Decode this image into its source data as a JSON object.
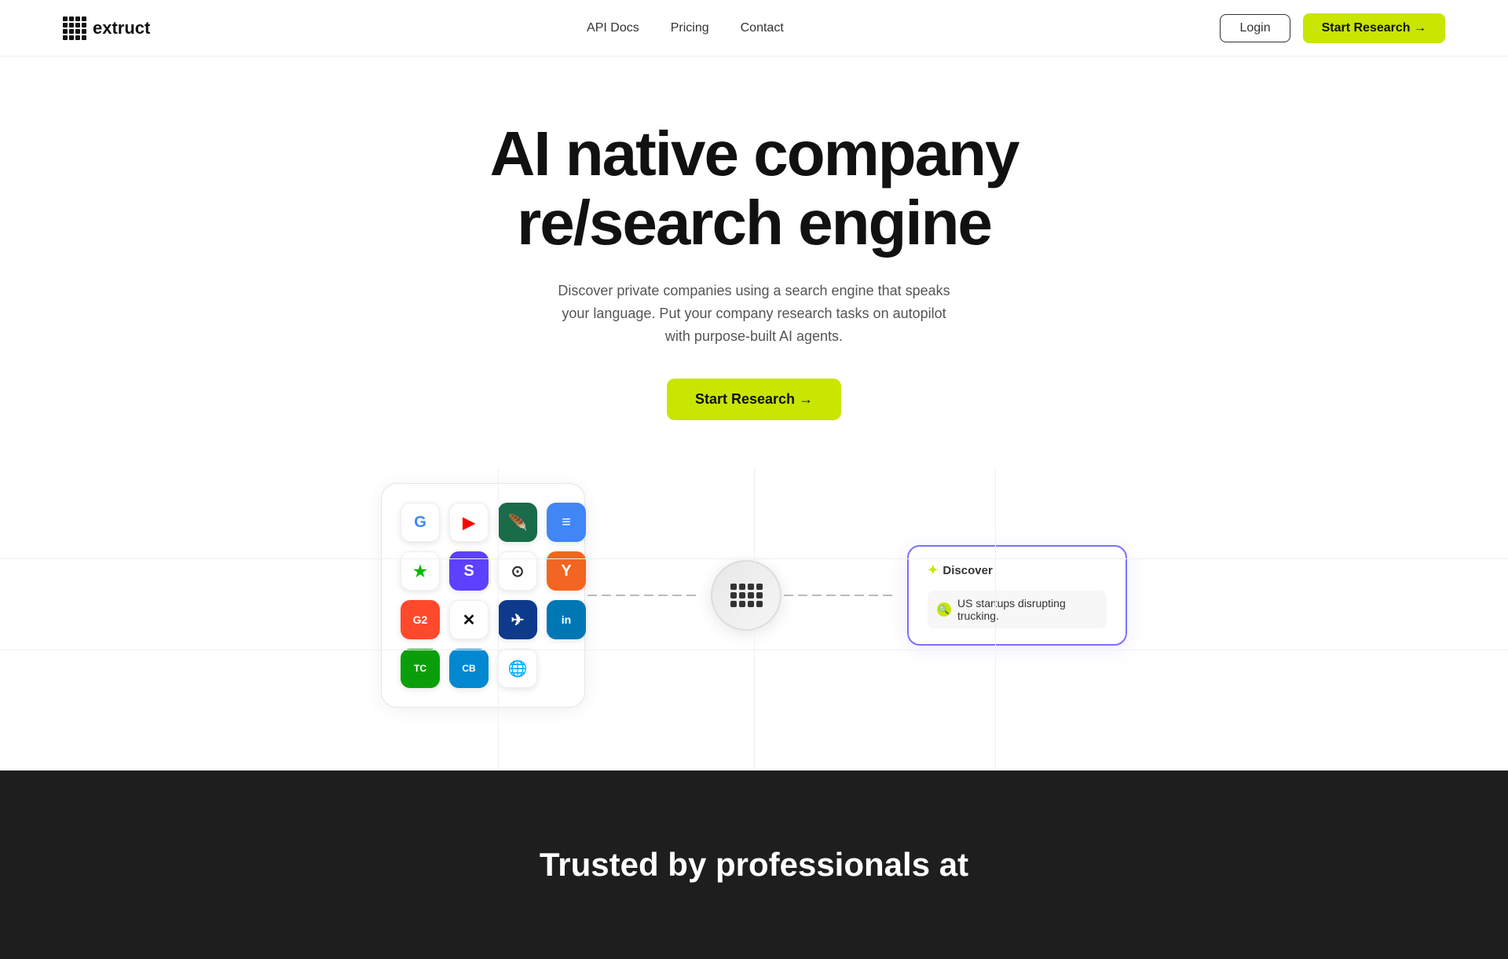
{
  "nav": {
    "logo_text": "extruct",
    "links": [
      {
        "label": "API Docs",
        "id": "api-docs"
      },
      {
        "label": "Pricing",
        "id": "pricing"
      },
      {
        "label": "Contact",
        "id": "contact"
      }
    ],
    "login_label": "Login",
    "start_research_label": "Start Research →"
  },
  "hero": {
    "title_line1": "AI native company",
    "title_line2": "re/search engine",
    "subtitle": "Discover private companies using a search engine that speaks your language. Put your company research tasks on autopilot with purpose-built AI agents.",
    "cta_label": "Start Research →"
  },
  "diagram": {
    "integrations": [
      {
        "name": "Google",
        "letter": "G",
        "color_class": "icon-google",
        "text_color": "#4285F4",
        "symbol": "G"
      },
      {
        "name": "YouTube",
        "color_class": "icon-youtube",
        "symbol": "▶",
        "text_color": "#FF0000"
      },
      {
        "name": "Feather",
        "color_class": "icon-feather",
        "symbol": "🪶",
        "text_color": "#fff"
      },
      {
        "name": "Google Docs",
        "color_class": "icon-docs",
        "symbol": "≡",
        "text_color": "#fff"
      },
      {
        "name": "Star",
        "color_class": "icon-star",
        "symbol": "★",
        "text_color": "#00aa00"
      },
      {
        "name": "Shortcut",
        "color_class": "icon-shortcut",
        "symbol": "S",
        "text_color": "#fff"
      },
      {
        "name": "GitHub",
        "color_class": "icon-github",
        "symbol": "⊙",
        "text_color": "#333"
      },
      {
        "name": "YC",
        "color_class": "icon-yc",
        "symbol": "Y",
        "text_color": "#fff"
      },
      {
        "name": "G2",
        "color_class": "icon-g2",
        "symbol": "G2",
        "text_color": "#fff"
      },
      {
        "name": "X",
        "color_class": "icon-x",
        "symbol": "✕",
        "text_color": "#111"
      },
      {
        "name": "Pitchbook",
        "color_class": "icon-pitchbook",
        "symbol": "✈",
        "text_color": "#fff"
      },
      {
        "name": "LinkedIn",
        "color_class": "icon-linkedin",
        "symbol": "in",
        "text_color": "#fff"
      },
      {
        "name": "TechCrunch",
        "color_class": "icon-techcrunch",
        "symbol": "TC",
        "text_color": "#fff"
      },
      {
        "name": "Crunchbase",
        "color_class": "icon-crunchbase",
        "symbol": "CB",
        "text_color": "#fff"
      },
      {
        "name": "Globe",
        "color_class": "icon-globe",
        "symbol": "🌐",
        "text_color": "#4285F4"
      }
    ],
    "hub_label": "extruct hub",
    "discover_card": {
      "header": "✦ Discover",
      "search_text": "US startups disrupting trucking."
    }
  },
  "bottom": {
    "text": "Trusted by professionals at"
  }
}
